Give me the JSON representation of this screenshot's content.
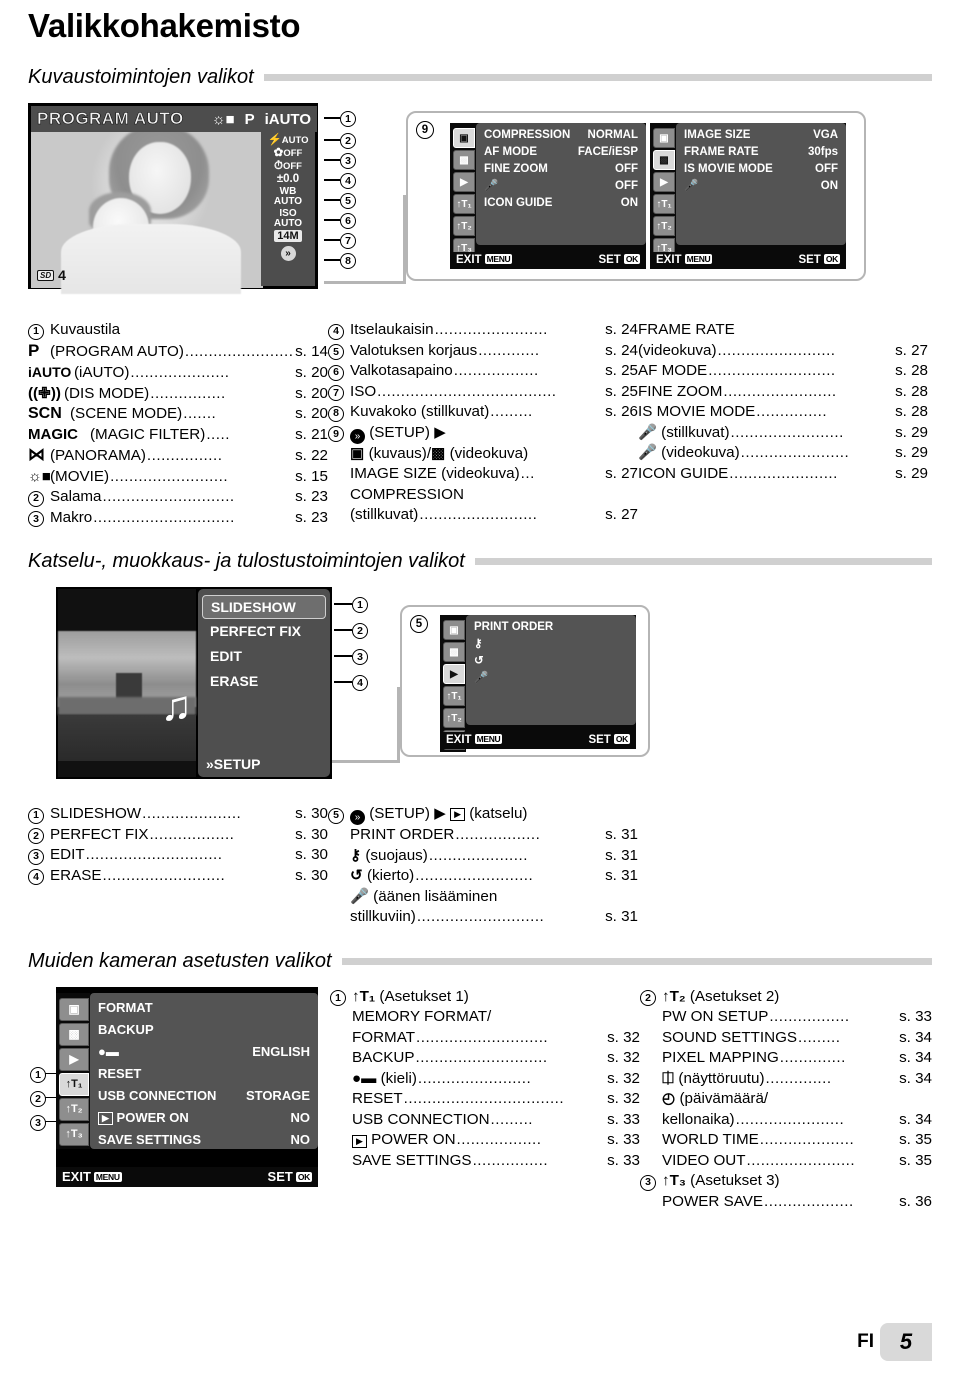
{
  "page": {
    "title": "Valikkohakemisto",
    "footer_lang": "FI",
    "footer_page": "5"
  },
  "sections": [
    {
      "id": "shooting",
      "heading": "Kuvaustoimintojen valikot"
    },
    {
      "id": "playback",
      "heading": "Katselu-, muokkaus- ja tulostustoimintojen valikot"
    },
    {
      "id": "setup",
      "heading": "Muiden kameran asetusten valikot"
    }
  ],
  "fig1": {
    "lcd": {
      "mode_label": "PROGRAM AUTO",
      "top_modes": [
        "movie-icon",
        "P",
        "iAUTO"
      ],
      "sidebar": [
        {
          "n": "2",
          "line1": "AUTO",
          "icon": "flash-icon"
        },
        {
          "n": "3",
          "line1": "OFF",
          "icon": "macro-icon"
        },
        {
          "n": "4",
          "line1": "OFF",
          "icon": "selftimer-icon"
        },
        {
          "n": "5",
          "line1": "±0.0",
          "icon": ""
        },
        {
          "n": "6",
          "line1": "WB",
          "line2": "AUTO",
          "icon": ""
        },
        {
          "n": "7",
          "line1": "ISO",
          "line2": "AUTO",
          "icon": ""
        },
        {
          "n": "8",
          "line1": "14M",
          "icon": ""
        }
      ],
      "sd_badge": "SD",
      "sd_count": "4",
      "callouts": [
        "1",
        "2",
        "3",
        "4",
        "5",
        "6",
        "7",
        "8"
      ]
    },
    "callout9": "9",
    "menu_a": {
      "tabs": [
        "still-camera-icon",
        "movie-camera-icon",
        "playback-icon",
        "YT1",
        "YT2",
        "YT3"
      ],
      "selected_tab": 0,
      "rows": [
        {
          "name": "COMPRESSION",
          "value": "NORMAL"
        },
        {
          "name": "AF MODE",
          "value": "FACE/iESP"
        },
        {
          "name": "FINE ZOOM",
          "value": "OFF"
        },
        {
          "name": "mic-icon",
          "value": "OFF"
        },
        {
          "name": "ICON GUIDE",
          "value": "ON"
        }
      ],
      "exit": "EXIT",
      "exit_key": "MENU",
      "set": "SET",
      "set_key": "OK"
    },
    "menu_b": {
      "tabs": [
        "still-camera-icon",
        "movie-camera-icon",
        "playback-icon",
        "YT1",
        "YT2",
        "YT3"
      ],
      "selected_tab": 1,
      "rows": [
        {
          "name": "IMAGE SIZE",
          "value": "VGA"
        },
        {
          "name": "FRAME RATE",
          "value": "30fps"
        },
        {
          "name": "IS MOVIE MODE",
          "value": "OFF"
        },
        {
          "name": "mic-icon",
          "value": "ON"
        }
      ],
      "exit": "EXIT",
      "exit_key": "MENU",
      "set": "SET",
      "set_key": "OK"
    }
  },
  "list1": {
    "col1": [
      {
        "bullet": "1",
        "name": "Kuvaustila",
        "page": ""
      },
      {
        "bullet": "",
        "glyph": "P",
        "name": "(PROGRAM AUTO)",
        "page": "s. 14"
      },
      {
        "bullet": "",
        "glyph": "iAUTO",
        "name": "(iAUTO)",
        "page": "s. 20"
      },
      {
        "bullet": "",
        "glyph": "((✙))",
        "name": "(DIS MODE)",
        "page": "s. 20"
      },
      {
        "bullet": "",
        "glyph": "SCN",
        "name": "(SCENE MODE)",
        "page": "s. 20"
      },
      {
        "bullet": "",
        "glyph": "MAGIC",
        "name": "(MAGIC FILTER)",
        "page": "s. 21"
      },
      {
        "bullet": "",
        "glyph": "⋈",
        "name": "(PANORAMA)",
        "page": "s. 22"
      },
      {
        "bullet": "",
        "glyph": "movie",
        "name": "(MOVIE)",
        "page": "s. 15"
      },
      {
        "bullet": "2",
        "name": "Salama",
        "page": "s. 23"
      },
      {
        "bullet": "3",
        "name": "Makro",
        "page": "s. 23"
      }
    ],
    "col2": [
      {
        "bullet": "4",
        "name": "Itselaukaisin",
        "page": "s. 24"
      },
      {
        "bullet": "5",
        "name": "Valotuksen korjaus",
        "page": "s. 24"
      },
      {
        "bullet": "6",
        "name": "Valkotasapaino",
        "page": "s. 25"
      },
      {
        "bullet": "7",
        "name": "ISO",
        "page": "s. 25"
      },
      {
        "bullet": "8",
        "name": "Kuvakoko (stillkuvat)",
        "page": "s. 26"
      },
      {
        "bullet": "9",
        "glyph": "setup",
        "name": "(SETUP) ▶",
        "page": ""
      },
      {
        "bullet": "",
        "glyph": "camera/movie",
        "name": "(kuvaus)/ (videokuva)",
        "page": ""
      },
      {
        "bullet": "",
        "name": "IMAGE SIZE (videokuva)",
        "page": "s. 27"
      },
      {
        "bullet": "",
        "name": "COMPRESSION",
        "page": ""
      },
      {
        "bullet": "",
        "name": "(stillkuvat)",
        "page": "s. 27"
      }
    ],
    "col3": [
      {
        "name": "FRAME RATE",
        "page": ""
      },
      {
        "name": "(videokuva)",
        "page": "s. 27"
      },
      {
        "name": "AF MODE",
        "page": "s. 28"
      },
      {
        "name": "FINE ZOOM",
        "page": "s. 28"
      },
      {
        "name": "IS MOVIE MODE",
        "page": "s. 28"
      },
      {
        "glyph": "mic",
        "name": "(stillkuvat)",
        "page": "s. 29"
      },
      {
        "glyph": "mic",
        "name": "(videokuva)",
        "page": "s. 29"
      },
      {
        "name": "ICON GUIDE",
        "page": "s. 29"
      }
    ]
  },
  "fig2": {
    "menu_items": [
      {
        "label": "SLIDESHOW",
        "selected": true,
        "callout": "1"
      },
      {
        "label": "PERFECT FIX",
        "selected": false,
        "callout": "2"
      },
      {
        "label": "EDIT",
        "selected": false,
        "callout": "3"
      },
      {
        "label": "ERASE",
        "selected": false,
        "callout": "4"
      }
    ],
    "setup_label": "SETUP",
    "callout5": "5",
    "menu_c": {
      "tabs": [
        "still-camera-icon",
        "movie-camera-icon",
        "playback-icon",
        "YT1",
        "YT2",
        "YT3"
      ],
      "selected_tab": 2,
      "rows": [
        {
          "name": "PRINT ORDER",
          "value": ""
        },
        {
          "name": "key-icon",
          "value": ""
        },
        {
          "name": "rotate-icon",
          "value": ""
        },
        {
          "name": "mic-icon",
          "value": ""
        }
      ],
      "exit": "EXIT",
      "exit_key": "MENU",
      "set": "SET",
      "set_key": "OK"
    }
  },
  "list2": {
    "col1": [
      {
        "bullet": "1",
        "name": "SLIDESHOW",
        "page": "s. 30"
      },
      {
        "bullet": "2",
        "name": "PERFECT FIX",
        "page": "s. 30"
      },
      {
        "bullet": "3",
        "name": "EDIT",
        "page": "s. 30"
      },
      {
        "bullet": "4",
        "name": "ERASE",
        "page": "s. 30"
      }
    ],
    "col2": [
      {
        "bullet": "5",
        "glyph": "setup",
        "name": "(SETUP) ▶  (katselu)",
        "page": ""
      },
      {
        "bullet": "",
        "name": "PRINT ORDER",
        "page": "s. 31"
      },
      {
        "bullet": "",
        "glyph": "key",
        "name": "(suojaus)",
        "page": "s. 31"
      },
      {
        "bullet": "",
        "glyph": "rotate",
        "name": "(kierto)",
        "page": "s. 31"
      },
      {
        "bullet": "",
        "glyph": "mic",
        "name": "(äänen lisääminen",
        "page": ""
      },
      {
        "bullet": "",
        "name": "stillkuviin)",
        "page": "s. 31"
      }
    ]
  },
  "fig3": {
    "menu_d": {
      "tabs": [
        "still-camera-icon",
        "movie-camera-icon",
        "playback-icon",
        "YT1",
        "YT2",
        "YT3"
      ],
      "selected_tab": 3,
      "rows": [
        {
          "name": "FORMAT",
          "value": ""
        },
        {
          "name": "BACKUP",
          "value": ""
        },
        {
          "name": "language-icon",
          "value": "ENGLISH"
        },
        {
          "name": "RESET",
          "value": ""
        },
        {
          "name": "USB CONNECTION",
          "value": "STORAGE"
        },
        {
          "name": "POWER ON",
          "value": "NO",
          "prefix": "playback-icon"
        },
        {
          "name": "SAVE SETTINGS",
          "value": "NO"
        }
      ],
      "exit": "EXIT",
      "exit_key": "MENU",
      "set": "SET",
      "set_key": "OK"
    },
    "callouts": [
      "1",
      "2",
      "3"
    ]
  },
  "list3": {
    "col1": [
      {
        "bullet": "1",
        "glyph": "YT1",
        "name": "(Asetukset 1)",
        "page": ""
      },
      {
        "bullet": "",
        "name": "MEMORY FORMAT/",
        "page": ""
      },
      {
        "bullet": "",
        "name": "FORMAT",
        "page": "s. 32"
      },
      {
        "bullet": "",
        "name": "BACKUP",
        "page": "s. 32"
      },
      {
        "bullet": "",
        "glyph": "language",
        "name": "(kieli)",
        "page": "s. 32"
      },
      {
        "bullet": "",
        "name": "RESET",
        "page": "s. 32"
      },
      {
        "bullet": "",
        "name": "USB CONNECTION",
        "page": "s. 33"
      },
      {
        "bullet": "",
        "glyph": "playback",
        "name": "POWER ON",
        "page": "s. 33"
      },
      {
        "bullet": "",
        "name": "SAVE SETTINGS",
        "page": "s. 33"
      }
    ],
    "col2": [
      {
        "bullet": "2",
        "glyph": "YT2",
        "name": "(Asetukset 2)",
        "page": ""
      },
      {
        "bullet": "",
        "name": "PW ON SETUP",
        "page": "s. 33"
      },
      {
        "bullet": "",
        "name": "SOUND SETTINGS",
        "page": "s. 34"
      },
      {
        "bullet": "",
        "name": "PIXEL MAPPING",
        "page": "s. 34"
      },
      {
        "bullet": "",
        "glyph": "monitor",
        "name": "(näyttöruutu)",
        "page": "s. 34"
      },
      {
        "bullet": "",
        "glyph": "clock",
        "name": "(päivämäärä/",
        "page": ""
      },
      {
        "bullet": "",
        "name": "kellonaika)",
        "page": "s. 34"
      },
      {
        "bullet": "",
        "name": "WORLD TIME",
        "page": "s. 35"
      },
      {
        "bullet": "",
        "name": "VIDEO OUT",
        "page": "s. 35"
      },
      {
        "bullet": "3",
        "glyph": "YT3",
        "name": "(Asetukset 3)",
        "page": ""
      },
      {
        "bullet": "",
        "name": "POWER SAVE",
        "page": "s. 36"
      }
    ]
  }
}
